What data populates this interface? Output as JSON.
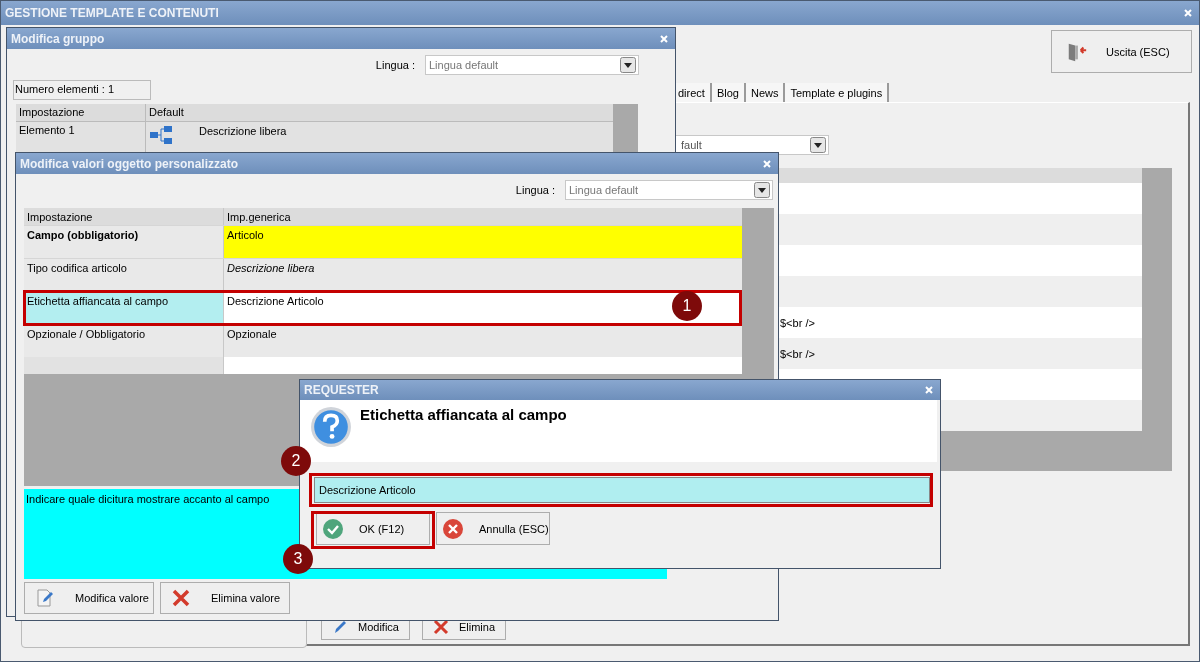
{
  "main_window": {
    "title": "GESTIONE TEMPLATE E CONTENUTI",
    "exit_button": "Uscita (ESC)",
    "tabs": [
      {
        "label": "direct",
        "selected": false
      },
      {
        "label": "Blog",
        "selected": false
      },
      {
        "label": "News",
        "selected": false
      },
      {
        "label": "Template e plugins",
        "selected": false
      }
    ],
    "language_select": {
      "value": "fault"
    },
    "grid_cells": [
      "$<br />",
      "$<br />"
    ],
    "buttons": [
      "Modifica",
      "Elimina"
    ]
  },
  "group_dialog": {
    "title": "Modifica gruppo",
    "language_label": "Lingua :",
    "language_select": {
      "value": "Lingua default"
    },
    "count": "Numero elementi : 1",
    "columns": [
      "Impostazione",
      "Default"
    ],
    "rows": [
      {
        "name": "Elemento 1",
        "value": "Descrizione libera"
      }
    ]
  },
  "values_dialog": {
    "title": "Modifica valori oggetto personalizzato",
    "language_label": "Lingua :",
    "language_select": {
      "value": "Lingua default"
    },
    "columns": [
      "Impostazione",
      "Imp.generica"
    ],
    "rows": [
      {
        "setting": "Campo (obbligatorio)",
        "value": "Articolo",
        "kind": "required",
        "selected": false
      },
      {
        "setting": "Tipo codifica articolo",
        "value": "Descrizione libera",
        "kind": "inherited",
        "selected": false
      },
      {
        "setting": "Etichetta affiancata al campo",
        "value": "Descrizione Articolo",
        "kind": "plain",
        "selected": true
      },
      {
        "setting": "Opzionale / Obbligatorio",
        "value": "Opzionale",
        "kind": "plain",
        "selected": false
      }
    ],
    "description": "Indicare quale dicitura mostrare accanto al campo",
    "buttons": [
      "Modifica valore",
      "Elimina valore"
    ]
  },
  "requester": {
    "title": "REQUESTER",
    "question": "Etichetta affiancata al campo",
    "input": {
      "value": "Descrizione Articolo"
    },
    "ok_button": "OK (F12)",
    "cancel_button": "Annulla (ESC)"
  },
  "callouts": [
    {
      "number": "1"
    },
    {
      "number": "2"
    },
    {
      "number": "3"
    }
  ]
}
